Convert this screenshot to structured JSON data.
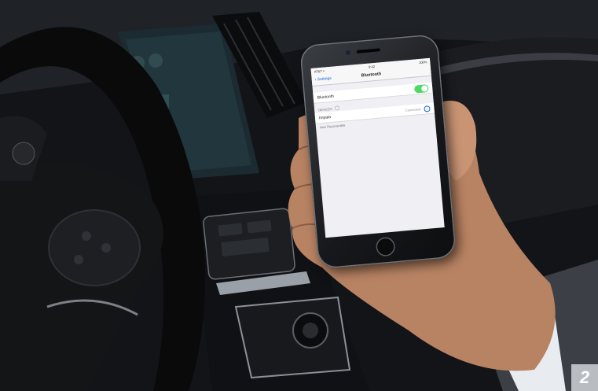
{
  "phone": {
    "status": {
      "carrier": "AT&T ≈",
      "time": "9:42",
      "battery": "100%"
    },
    "nav": {
      "back_label": "Settings",
      "title": "Bluetooth"
    },
    "bluetooth_row": {
      "label": "Bluetooth",
      "toggle_on": true
    },
    "devices_header": "DEVICES",
    "device_row": {
      "name": "Impala",
      "status": "Connected"
    },
    "discoverable_text": "Now Discoverable"
  },
  "page_number": "2",
  "colors": {
    "toggle_on": "#4cd964",
    "ios_blue": "#0a63d8",
    "badge": "#b9bcc1"
  }
}
